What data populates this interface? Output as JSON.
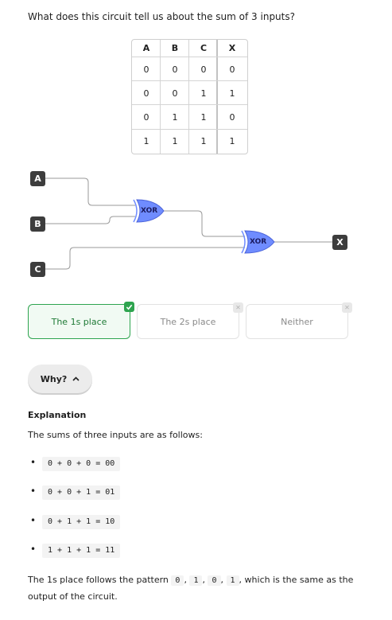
{
  "question": "What does this circuit tell us about the sum of 3 inputs?",
  "truth_table": {
    "headers": [
      "A",
      "B",
      "C",
      "X"
    ],
    "rows": [
      [
        "0",
        "0",
        "0",
        "0"
      ],
      [
        "0",
        "0",
        "1",
        "1"
      ],
      [
        "0",
        "1",
        "1",
        "0"
      ],
      [
        "1",
        "1",
        "1",
        "1"
      ]
    ]
  },
  "circuit": {
    "inputs": [
      "A",
      "B",
      "C"
    ],
    "output": "X",
    "gates": [
      "XOR",
      "XOR"
    ],
    "gate_color": "#6f8cff"
  },
  "choices": [
    {
      "label": "The 1s place",
      "status": "correct"
    },
    {
      "label": "The 2s place",
      "status": "incorrect"
    },
    {
      "label": "Neither",
      "status": "incorrect"
    }
  ],
  "why_button": {
    "label": "Why?",
    "icon": "chevron-up-icon"
  },
  "explanation": {
    "title": "Explanation",
    "intro": "The sums of three inputs are as follows:",
    "sums": [
      "0 + 0 + 0 = 00",
      "0 + 0 + 1 = 01",
      "0 + 1 + 1 = 10",
      "1 + 1 + 1 = 11"
    ],
    "conclusion_before": "The 1s place follows the pattern",
    "pattern": [
      "0",
      "1",
      "0",
      "1"
    ],
    "conclusion_after": ", which is the same as the output of the circuit."
  },
  "colors": {
    "correct": "#2ea44f",
    "gate": "#6f8cff",
    "pin": "#3d3d3d"
  }
}
